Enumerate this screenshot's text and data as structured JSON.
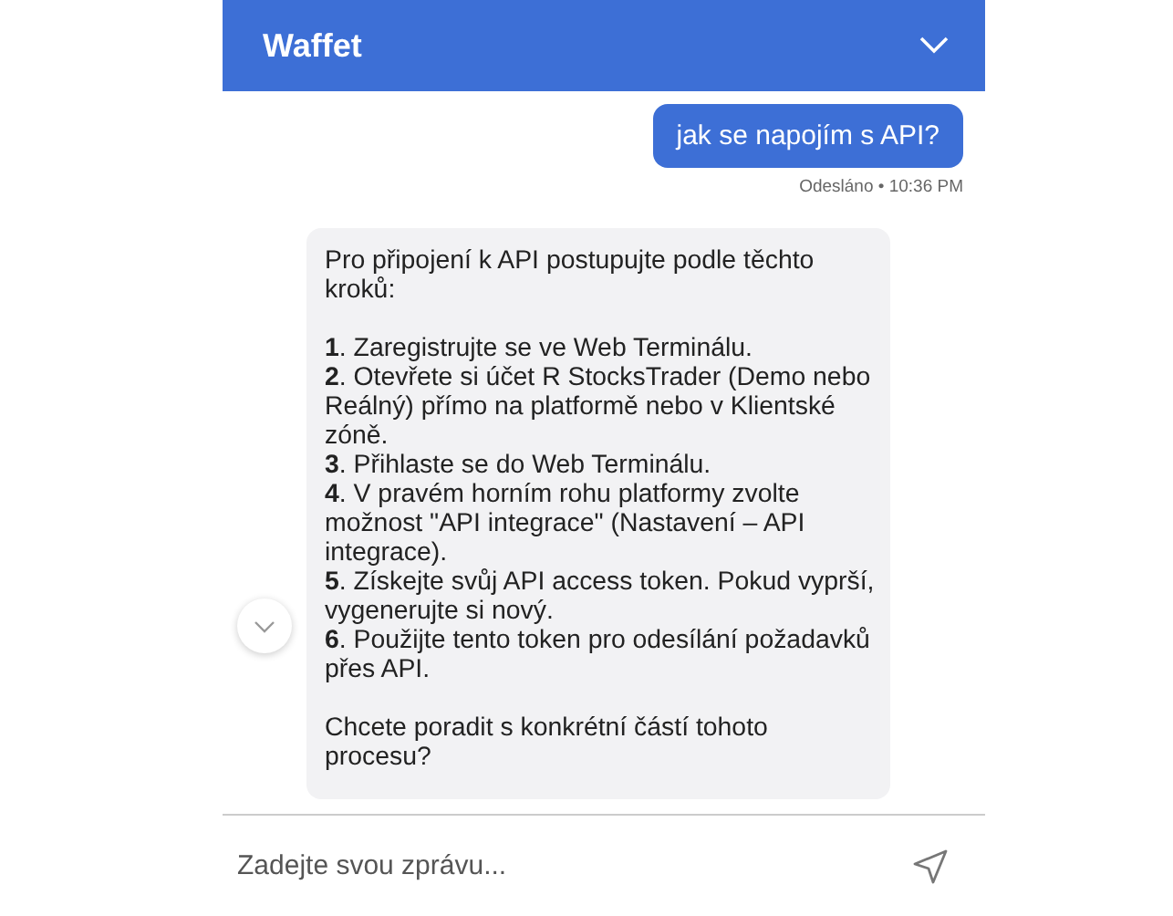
{
  "header": {
    "title": "Waffet"
  },
  "messages": [
    {
      "kind": "user",
      "text": "jak se napojím s API?",
      "status": "Odesláno • 10:36 PM"
    },
    {
      "kind": "bot",
      "intro": "Pro připojení k API postupujte podle těchto kroků:",
      "steps": [
        "**1**. Zaregistrujte se ve Web Terminálu.",
        "**2**. Otevřete si účet R StocksTrader (Demo nebo Reálný) přímo na platformě nebo v Klientské zóně.",
        "**3**. Přihlaste se do Web Terminálu.",
        "**4**. V pravém horním rohu platformy zvolte možnost \"API integrace\" (Nastavení – API integrace).",
        "**5**. Získejte svůj API access token. Pokud vyprší, vygenerujte si nový.",
        "**6**. Použijte tento token pro odesílání požadavků přes API."
      ],
      "outro": "Chcete poradit s konkrétní částí tohoto procesu?"
    }
  ],
  "composer": {
    "placeholder": "Zadejte svou zprávu..."
  }
}
